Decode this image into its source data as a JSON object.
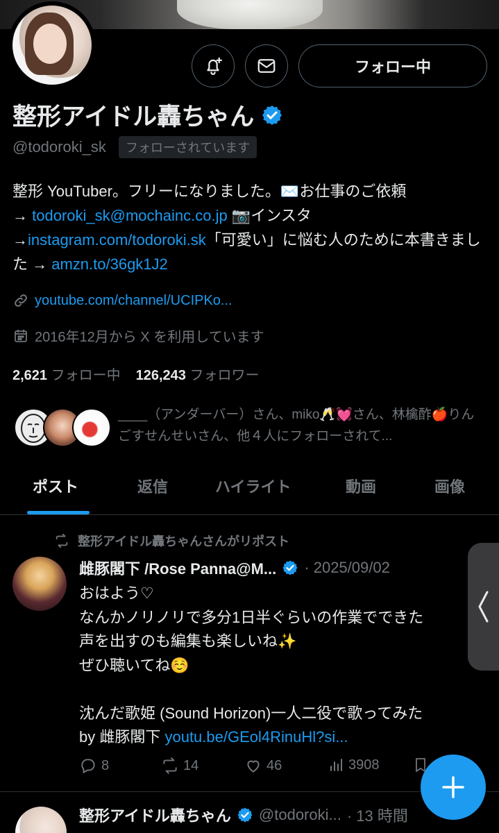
{
  "profile": {
    "name": "整形アイドル轟ちゃん",
    "handle": "@todoroki_sk",
    "follows_you": "フォローされています",
    "follow_button": "フォロー中",
    "bio_line1": "整形 YouTuber。フリーになりました。",
    "bio_mail_emoji": "✉️",
    "bio_line1b": "お仕事のご依頼",
    "bio_arrow1": "→ ",
    "bio_email": "todoroki_sk@mochainc.co.jp",
    "bio_camera": " 📷",
    "bio_insta_label": "インスタ",
    "bio_arrow2": "→",
    "bio_insta": "instagram.com/todoroki.sk",
    "bio_book": "「可愛い」に悩む人のために本書きました → ",
    "bio_amzn": "amzn.to/36gk1J2",
    "website": "youtube.com/channel/UCIPKo...",
    "joined": "2016年12月から X を利用しています",
    "following_count": "2,621",
    "following_label": "フォロー中",
    "followers_count": "126,243",
    "followers_label": "フォロワー",
    "followed_by": "____（アンダーバー）さん、miko🥂💓さん、林檎酢🍎りんごすせんせいさん、他４人にフォローされて..."
  },
  "tabs": [
    "ポスト",
    "返信",
    "ハイライト",
    "動画",
    "画像"
  ],
  "post1": {
    "repost_label": "整形アイドル轟ちゃんさんがリポスト",
    "author": "雌豚閣下 /Rose Panna@M...",
    "date": "· 2025/09/02",
    "body": "おはよう♡\nなんかノリノリで多分1日半ぐらいの作業でできた\n声を出すのも編集も楽しいね✨\nぜひ聴いてね☺️\n\n沈んだ歌姫 (Sound Horizon)一人二役で歌ってみた\nby 雌豚閣下 ",
    "link": "youtu.be/GEol4RinuHl?si...",
    "replies": "8",
    "reposts": "14",
    "likes": "46",
    "views": "3908"
  },
  "post2": {
    "author": "整形アイドル轟ちゃん",
    "handle": "@todoroki...",
    "time": "· 13 時間"
  },
  "colors": {
    "accent": "#1d9bf0",
    "muted": "#71767b",
    "text": "#e7e9ea",
    "background": "#000000"
  }
}
